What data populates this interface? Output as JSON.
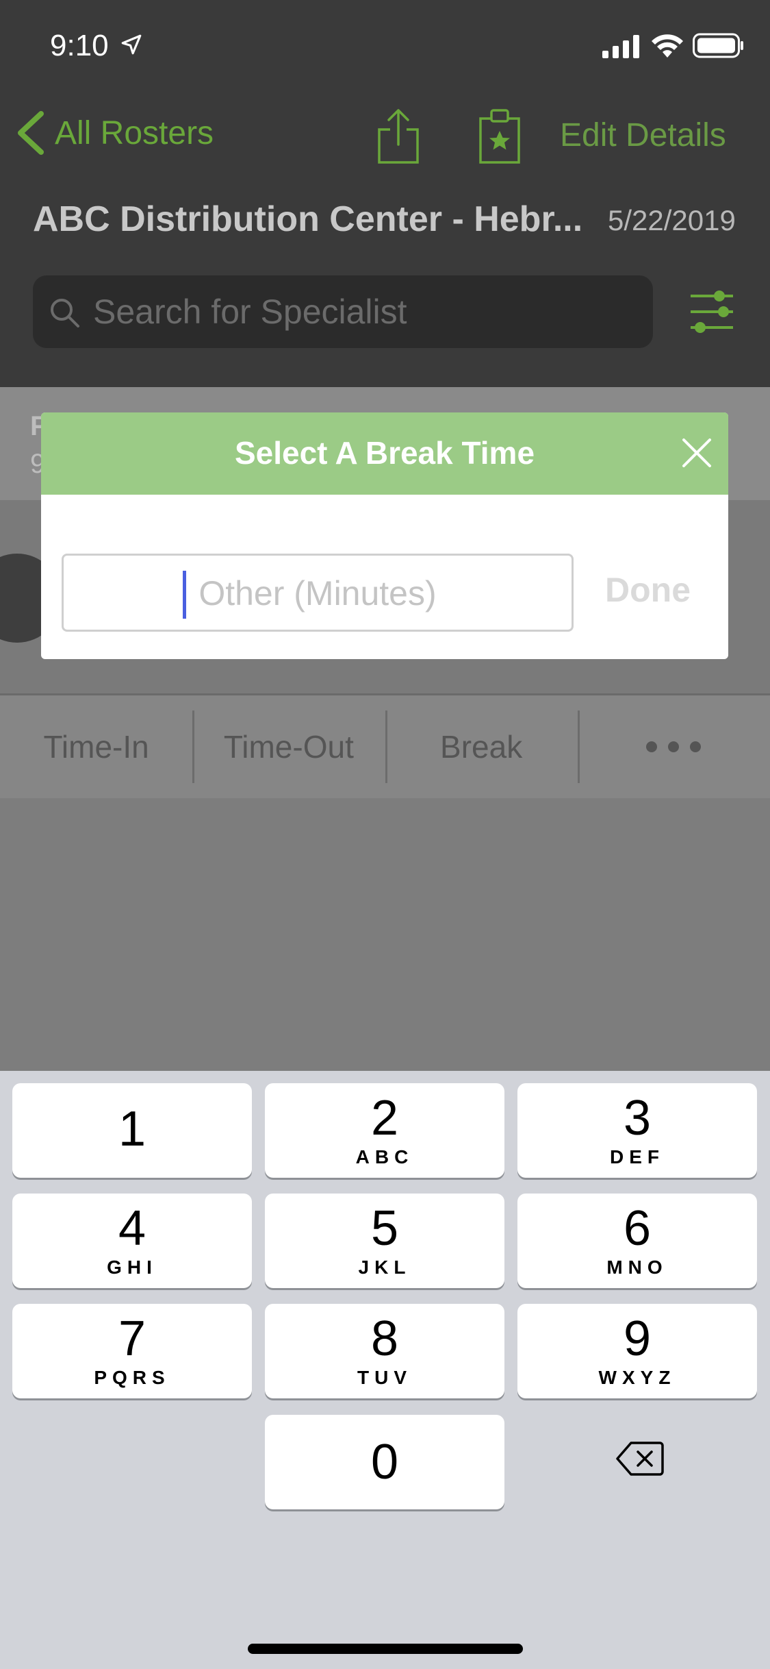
{
  "status_bar": {
    "time": "9:10"
  },
  "nav": {
    "back_label": "All Rosters",
    "edit_label": "Edit Details"
  },
  "roster": {
    "title": "ABC Distribution Center - Hebr...",
    "date": "5/22/2019"
  },
  "search": {
    "placeholder": "Search for Specialist"
  },
  "background_row": {
    "cut_text_1": "F",
    "cut_text_2": "9"
  },
  "tabs": [
    "Time-In",
    "Time-Out",
    "Break"
  ],
  "modal": {
    "title": "Select A Break Time",
    "input_placeholder": "Other (Minutes)",
    "done_label": "Done"
  },
  "keyboard": {
    "keys": [
      {
        "num": "1",
        "letters": ""
      },
      {
        "num": "2",
        "letters": "ABC"
      },
      {
        "num": "3",
        "letters": "DEF"
      },
      {
        "num": "4",
        "letters": "GHI"
      },
      {
        "num": "5",
        "letters": "JKL"
      },
      {
        "num": "6",
        "letters": "MNO"
      },
      {
        "num": "7",
        "letters": "PQRS"
      },
      {
        "num": "8",
        "letters": "TUV"
      },
      {
        "num": "9",
        "letters": "WXYZ"
      },
      {
        "num": "0",
        "letters": ""
      }
    ]
  },
  "colors": {
    "accent": "#6aa83a",
    "modal_header": "#9bcb86",
    "caret": "#4a5fe0"
  }
}
